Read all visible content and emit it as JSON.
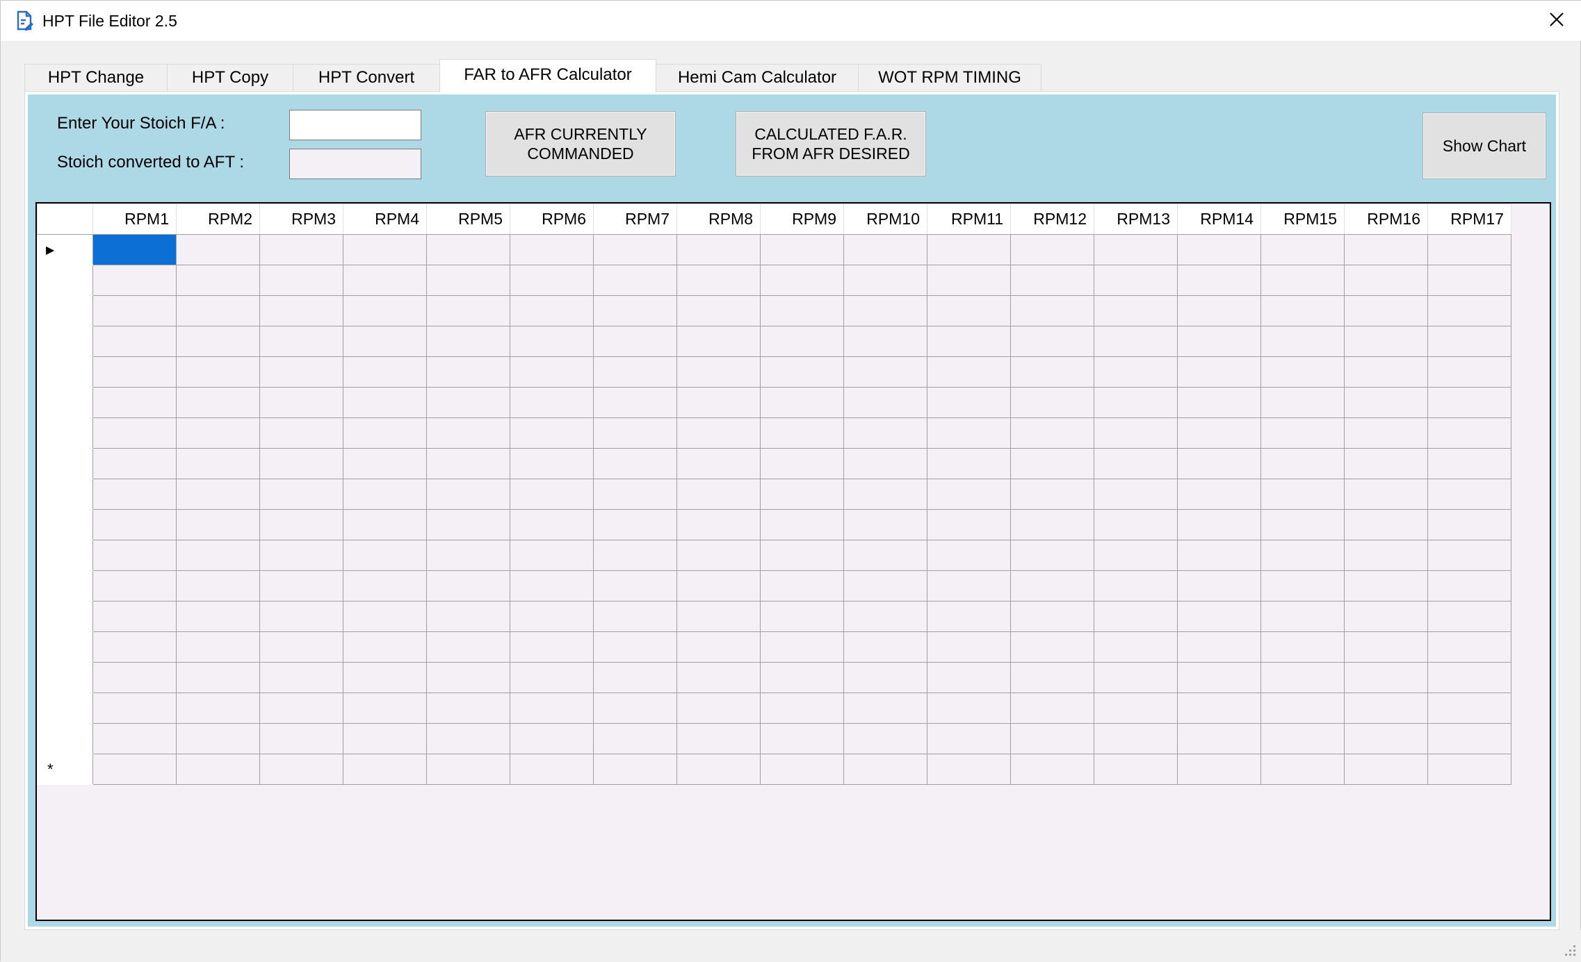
{
  "window": {
    "title": "HPT File Editor 2.5",
    "app_icon": "file-edit-icon",
    "close_icon": "close-icon"
  },
  "tabs": [
    {
      "label": "HPT Change",
      "active": false
    },
    {
      "label": "HPT Copy",
      "active": false
    },
    {
      "label": "HPT Convert",
      "active": false
    },
    {
      "label": "FAR to AFR Calculator",
      "active": true
    },
    {
      "label": "Hemi Cam Calculator",
      "active": false
    },
    {
      "label": "WOT RPM TIMING",
      "active": false
    }
  ],
  "form": {
    "stoich_label": "Enter Your Stoich F/A :",
    "stoich_value": "",
    "converted_label": "Stoich converted to AFT :",
    "converted_value": ""
  },
  "buttons": {
    "afr_commanded": "AFR CURRENTLY\nCOMMANDED",
    "far_calculated": "CALCULATED F.A.R.\nFROM AFR DESIRED",
    "show_chart": "Show Chart"
  },
  "grid": {
    "columns": [
      "RPM1",
      "RPM2",
      "RPM3",
      "RPM4",
      "RPM5",
      "RPM6",
      "RPM7",
      "RPM8",
      "RPM9",
      "RPM10",
      "RPM11",
      "RPM12",
      "RPM13",
      "RPM14",
      "RPM15",
      "RPM16",
      "RPM17"
    ],
    "row_count": 18,
    "current_row_marker": "▶",
    "new_row_marker": "*"
  },
  "colors": {
    "tab_page_bg": "#add8e6",
    "grid_bg": "#f5f0f5",
    "selection": "#0b6fd6"
  }
}
